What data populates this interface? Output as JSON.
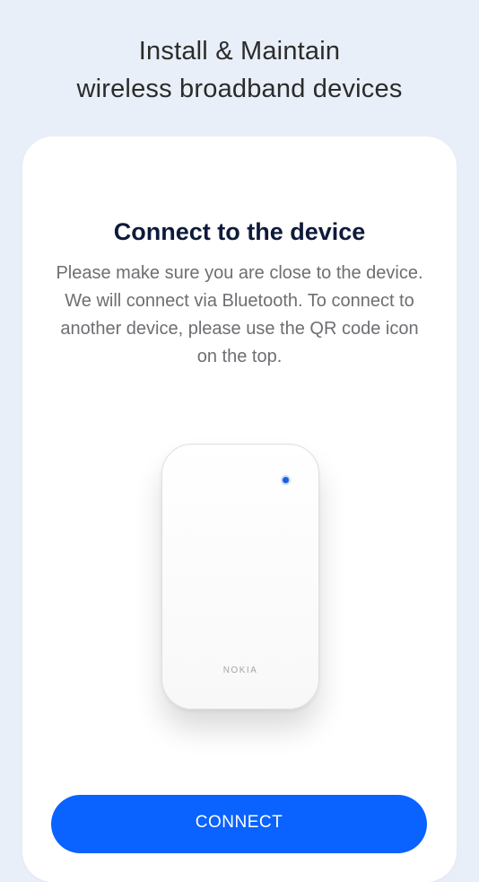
{
  "header": {
    "line1": "Install & Maintain",
    "line2": "wireless broadband devices"
  },
  "card": {
    "title": "Connect to the device",
    "description": "Please make sure you are close to the device. We will connect via Bluetooth. To connect to another device, please use the QR code icon on the top."
  },
  "device": {
    "brand": "NOKIA",
    "led_color": "#1b5fe0"
  },
  "actions": {
    "connect_label": "CONNECT"
  },
  "colors": {
    "background": "#e9eff8",
    "accent": "#0a62ff",
    "title": "#0d1a3a"
  }
}
